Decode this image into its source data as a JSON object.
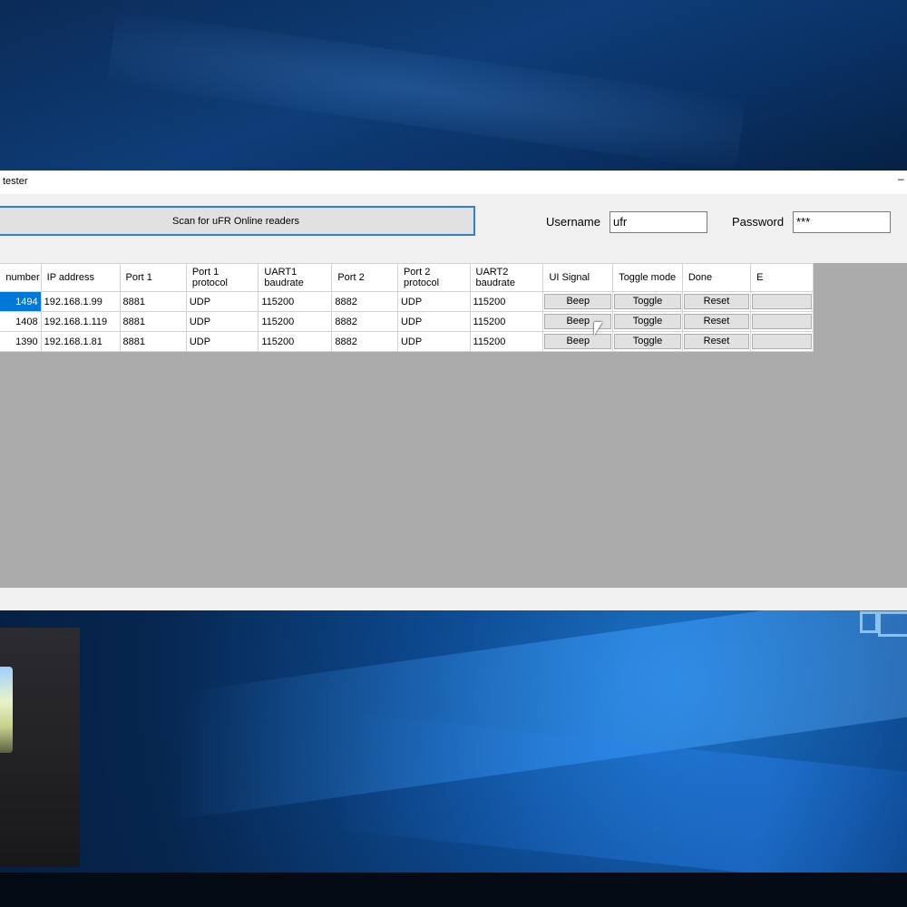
{
  "window": {
    "title": "tester"
  },
  "toolbar": {
    "scan_label": "Scan for uFR Online readers",
    "username_label": "Username",
    "username_value": "ufr",
    "password_label": "Password",
    "password_value": "***"
  },
  "grid": {
    "headers": [
      "number",
      "IP address",
      "Port 1",
      "Port 1\nprotocol",
      "UART1\nbaudrate",
      "Port 2",
      "Port 2\nprotocol",
      "UART2\nbaudrate",
      "UI Signal",
      "Toggle mode",
      "Done",
      "E"
    ],
    "rows": [
      {
        "number": "1494",
        "ip": "192.168.1.99",
        "port1": "8881",
        "port1_protocol": "UDP",
        "uart1": "115200",
        "port2": "8882",
        "port2_protocol": "UDP",
        "uart2": "115200",
        "ui_signal": "Beep",
        "toggle": "Toggle",
        "done": "Reset"
      },
      {
        "number": "1408",
        "ip": "192.168.1.119",
        "port1": "8881",
        "port1_protocol": "UDP",
        "uart1": "115200",
        "port2": "8882",
        "port2_protocol": "UDP",
        "uart2": "115200",
        "ui_signal": "Beep",
        "toggle": "Toggle",
        "done": "Reset"
      },
      {
        "number": "1390",
        "ip": "192.168.1.81",
        "port1": "8881",
        "port1_protocol": "UDP",
        "uart1": "115200",
        "port2": "8882",
        "port2_protocol": "UDP",
        "uart2": "115200",
        "ui_signal": "Beep",
        "toggle": "Toggle",
        "done": "Reset"
      }
    ]
  },
  "colors": {
    "selection": "#0078d7",
    "grid_background": "#ababab",
    "focus_border": "#2f7fd2"
  }
}
